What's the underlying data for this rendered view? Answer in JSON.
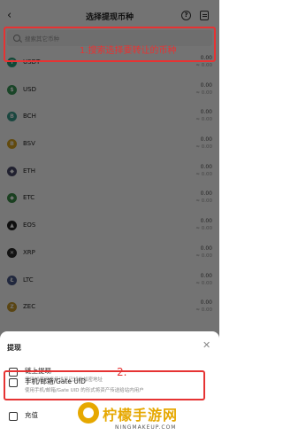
{
  "nav": {
    "title": "选择提现币种",
    "back_icon": "back-arrow-icon",
    "help_icon": "help-icon",
    "records_icon": "records-icon"
  },
  "search": {
    "placeholder": "搜索其它币种",
    "icon": "search-icon"
  },
  "annotations": {
    "step1": "1.搜索选择要转让的币种",
    "step2": "2.",
    "color": "#e63333"
  },
  "coins": [
    {
      "name": "USDT",
      "balance": "0.00",
      "value": "≈ 0.00",
      "color": "#26a17b"
    },
    {
      "name": "USD",
      "balance": "0.00",
      "value": "≈ 0.00",
      "color": "#3b9a5a"
    },
    {
      "name": "BCH",
      "balance": "0.00",
      "value": "≈ 0.00",
      "color": "#3a9c8c"
    },
    {
      "name": "BSV",
      "balance": "0.00",
      "value": "≈ 0.00",
      "color": "#d9a520"
    },
    {
      "name": "ETH",
      "balance": "0.00",
      "value": "≈ 0.00",
      "color": "#4a4a6a"
    },
    {
      "name": "ETC",
      "balance": "0.00",
      "value": "≈ 0.00",
      "color": "#3d8f4a"
    },
    {
      "name": "EOS",
      "balance": "0.00",
      "value": "≈ 0.00",
      "color": "#222222"
    },
    {
      "name": "XRP",
      "balance": "0.00",
      "value": "≈ 0.00",
      "color": "#2a2a2a"
    },
    {
      "name": "LTC",
      "balance": "0.00",
      "value": "≈ 0.00",
      "color": "#4a5a8a"
    },
    {
      "name": "ZEC",
      "balance": "0.00",
      "value": "≈ 0.00",
      "color": "#c89a2a"
    }
  ],
  "sheet": {
    "title": "提现",
    "close_icon": "close-icon",
    "options": [
      {
        "label": "链上提现",
        "desc": "使用加密网络传送至已知的加密地址",
        "icon": "chain-icon"
      },
      {
        "label": "手机/邮箱/Gate UID",
        "desc": "使用手机/邮箱/Gate UID 的形式将资产传送给站内用户",
        "icon": "user-card-icon"
      },
      {
        "label": "充值",
        "desc": "",
        "icon": "deposit-icon"
      }
    ]
  },
  "watermark": {
    "text": "柠檬手游网",
    "sub": "NINGMAKEUP.COM",
    "color": "#e6a800"
  }
}
